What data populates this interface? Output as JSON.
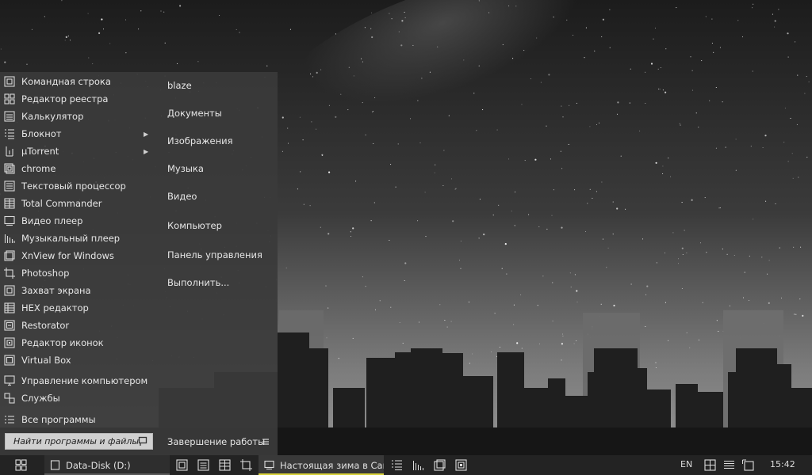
{
  "start_menu": {
    "programs": [
      {
        "label": "Командная строка",
        "icon": "command-prompt-icon",
        "arrow": false
      },
      {
        "label": "Редактор реестра",
        "icon": "registry-editor-icon",
        "arrow": false
      },
      {
        "label": "Калькулятор",
        "icon": "calculator-icon",
        "arrow": false
      },
      {
        "label": "Блокнот",
        "icon": "notepad-icon",
        "arrow": true
      },
      {
        "label": "µTorrent",
        "icon": "utorrent-icon",
        "arrow": true
      },
      {
        "label": "chrome",
        "icon": "chrome-icon",
        "arrow": false
      },
      {
        "label": "Текстовый процессор",
        "icon": "word-processor-icon",
        "arrow": false
      },
      {
        "label": "Total Commander",
        "icon": "total-commander-icon",
        "arrow": false
      },
      {
        "label": "Видео плеер",
        "icon": "video-player-icon",
        "arrow": false
      },
      {
        "label": "Музыкальный плеер",
        "icon": "music-player-icon",
        "arrow": false
      },
      {
        "label": "XnView for Windows",
        "icon": "xnview-icon",
        "arrow": false
      },
      {
        "label": "Photoshop",
        "icon": "photoshop-icon",
        "arrow": false
      },
      {
        "label": "Захват экрана",
        "icon": "screen-capture-icon",
        "arrow": false
      },
      {
        "label": "HEX редактор",
        "icon": "hex-editor-icon",
        "arrow": false
      },
      {
        "label": "Restorator",
        "icon": "restorator-icon",
        "arrow": false
      },
      {
        "label": "Редактор иконок",
        "icon": "icon-editor-icon",
        "arrow": false
      },
      {
        "label": "Virtual Box",
        "icon": "virtualbox-icon",
        "arrow": false
      },
      {
        "label": "Управление компьютером",
        "icon": "computer-management-icon",
        "arrow": false
      },
      {
        "label": "Службы",
        "icon": "services-icon",
        "arrow": false
      },
      {
        "label": "Все программы",
        "icon": "all-programs-icon",
        "arrow": false
      }
    ],
    "places": [
      "blaze",
      "Документы",
      "Изображения",
      "Музыка",
      "Видео",
      "Компьютер",
      "Панель управления",
      "Выполнить..."
    ],
    "search_placeholder": "Найти программы и файлы",
    "shutdown_label": "Завершение работы"
  },
  "taskbar": {
    "task_disk": "Data-Disk (D:)",
    "task_browser": "Настоящая зима в Сан...",
    "language": "EN",
    "clock": "15:42"
  }
}
